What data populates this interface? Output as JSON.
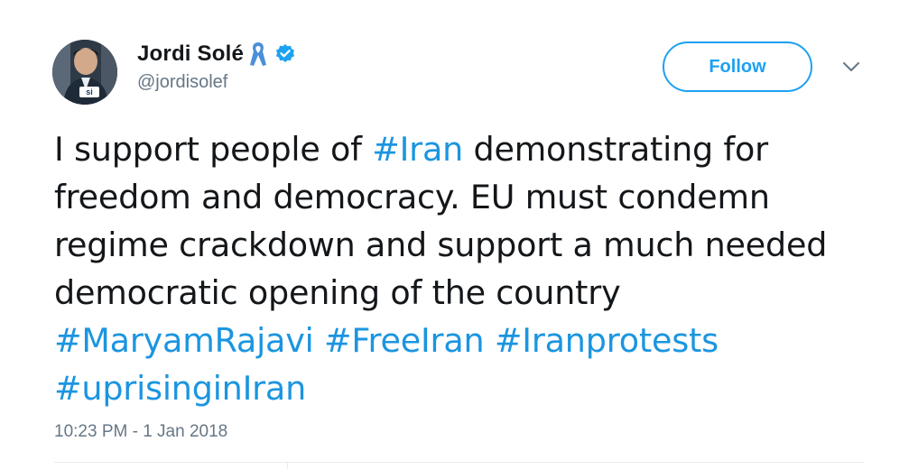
{
  "user": {
    "display_name": "Jordi Solé",
    "handle": "@jordisolef",
    "avatar_badge": "si"
  },
  "actions": {
    "follow_label": "Follow"
  },
  "tweet": {
    "segments": [
      {
        "text": "I support people of ",
        "hashtag": false
      },
      {
        "text": "#Iran",
        "hashtag": true
      },
      {
        "text": " demonstrating for freedom and democracy. EU must condemn regime crackdown and support a much needed democratic opening of the country ",
        "hashtag": false
      },
      {
        "text": "#MaryamRajavi",
        "hashtag": true
      },
      {
        "text": " ",
        "hashtag": false
      },
      {
        "text": "#FreeIran",
        "hashtag": true
      },
      {
        "text": " ",
        "hashtag": false
      },
      {
        "text": "#Iranprotests",
        "hashtag": true
      },
      {
        "text": " ",
        "hashtag": false
      },
      {
        "text": "#uprisinginIran",
        "hashtag": true
      }
    ],
    "timestamp": "10:23 PM - 1 Jan 2018"
  },
  "icons": {
    "ribbon": "awareness-ribbon-icon",
    "verified": "verified-badge-icon",
    "caret": "chevron-down-icon"
  },
  "colors": {
    "accent": "#1da1f2",
    "hashtag": "#1b95e0",
    "text": "#14171a",
    "muted": "#657786",
    "ribbon": "#4a90d9"
  }
}
